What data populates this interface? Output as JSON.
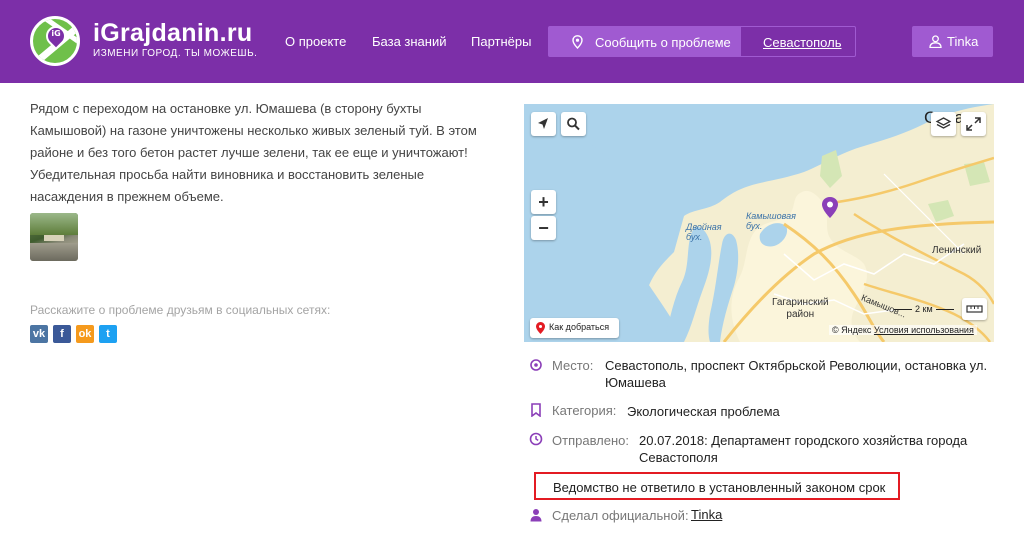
{
  "header": {
    "logo_title": "iGrajdanin.ru",
    "logo_subtitle": "ИЗМЕНИ ГОРОД. ТЫ МОЖЕШЬ.",
    "logo_badge": "iG",
    "nav": [
      "О проекте",
      "База знаний",
      "Партнёры"
    ],
    "report_button": "Сообщить о проблеме",
    "city": "Севастополь",
    "user": "Tinka",
    "brand_color": "#7c2fa8",
    "button_color": "#a05ad1"
  },
  "problem": {
    "description": "Рядом с переходом на остановке ул. Юмашева (в сторону бухты Камышовой) на газоне уничтожены несколько живых зеленый туй. В этом районе и без того бетон растет лучше зелени, так ее еще и уничтожают! Убедительная просьба найти виновника и восстановить зеленые насаждения в прежнем объеме.",
    "share_label": "Расскажите о проблеме друзьям в социальных сетях:",
    "social": [
      {
        "name": "vk",
        "glyph": "vk",
        "color": "#4c75a3"
      },
      {
        "name": "facebook",
        "glyph": "f",
        "color": "#3b5998"
      },
      {
        "name": "odnoklassniki",
        "glyph": "ok",
        "color": "#f59a1d"
      },
      {
        "name": "twitter",
        "glyph": "t",
        "color": "#1da1f2"
      }
    ]
  },
  "map": {
    "corner_label": "Сева",
    "labels": {
      "dvoynaya": "Двойная\nбух.",
      "kamyshovaya": "Камышовая\nбух.",
      "leninsky": "Ленинский",
      "gagarinsky": "Гагаринский\nрайон",
      "kamyshovoe": "Камышов..."
    },
    "route_button": "Как добраться",
    "scale": "2 км",
    "copyright": "© Яндекс",
    "terms": "Условия использования",
    "zoom_in": "+",
    "zoom_out": "−"
  },
  "details": {
    "place_label": "Место:",
    "place_value": "Севастополь, проспект Октябрьской Революции, остановка ул. Юмашева",
    "category_label": "Категория:",
    "category_value": "Экологическая проблема",
    "sent_label": "Отправлено:",
    "sent_value": "20.07.2018: Департамент городского хозяйства города Севастополя",
    "warning": "Ведомство не ответило в установленный законом срок",
    "official_label": "Сделал официальной:",
    "official_user": "Tinka",
    "icon_color": "#8b3fb8",
    "warning_border": "#e31b23"
  }
}
